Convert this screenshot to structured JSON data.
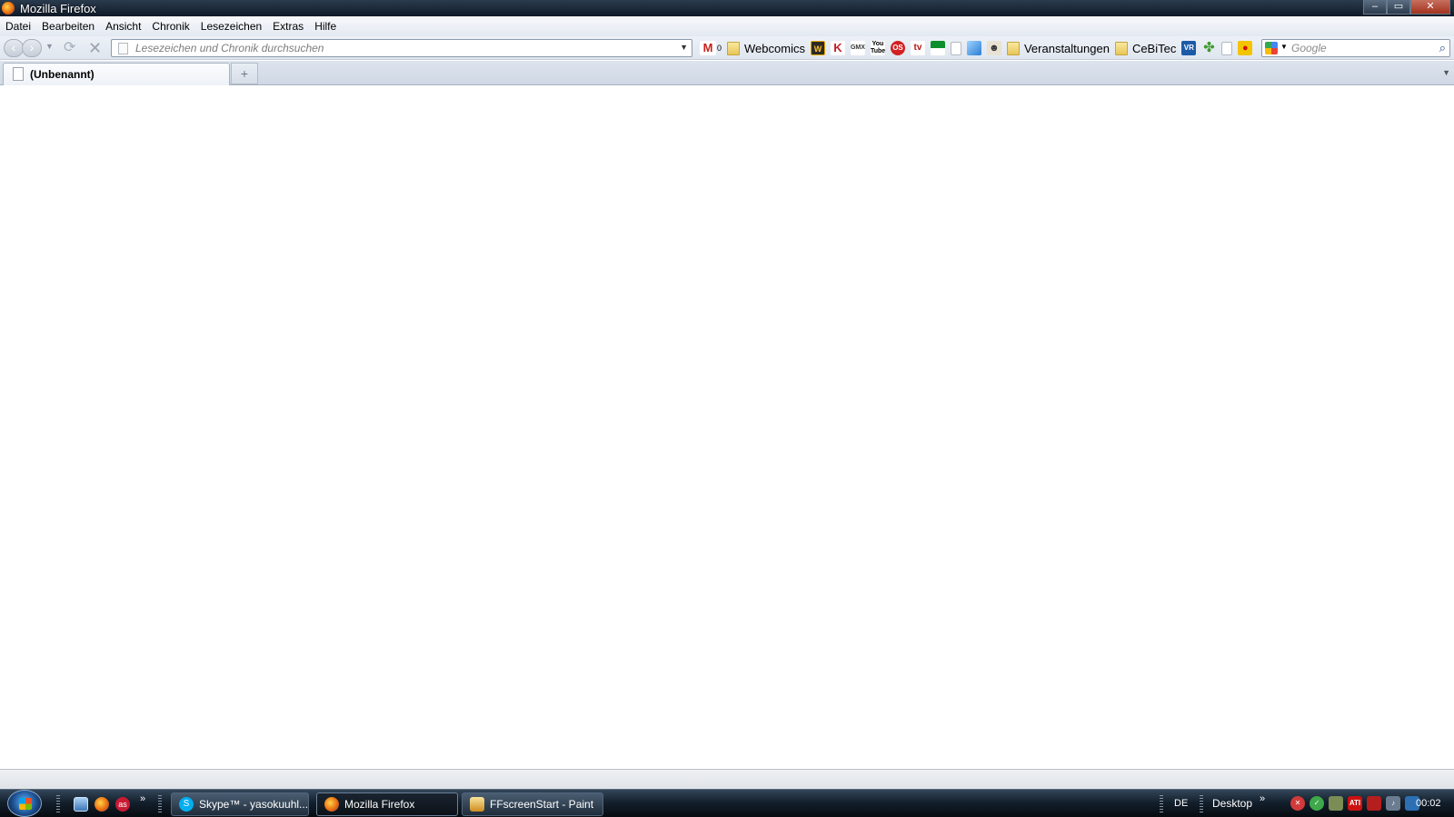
{
  "window": {
    "title": "Mozilla Firefox",
    "controls": {
      "minimize": "–",
      "maximize": "▭",
      "close": "✕"
    }
  },
  "menu": {
    "items": [
      "Datei",
      "Bearbeiten",
      "Ansicht",
      "Chronik",
      "Lesezeichen",
      "Extras",
      "Hilfe"
    ]
  },
  "nav": {
    "back_icon": "back-arrow-icon",
    "forward_icon": "forward-arrow-icon",
    "reload_icon": "reload-icon",
    "stop_icon": "stop-icon",
    "url_value": "",
    "url_placeholder": "Lesezeichen und Chronik durchsuchen"
  },
  "bookmarks": {
    "gmail_count": "0",
    "items": [
      {
        "label": "Webcomics",
        "icon": "folder-icon"
      },
      {
        "label": "Veranstaltungen",
        "icon": "folder-icon"
      },
      {
        "label": "CeBiTec",
        "icon": "folder-icon"
      }
    ],
    "icon_texts": {
      "wikipedia_de": "W",
      "kicker": "K",
      "gmx": "GMX",
      "youtube": "You Tube",
      "os": "OS",
      "tv": "tv",
      "vr": "VR"
    }
  },
  "search": {
    "value": "",
    "placeholder": "Google",
    "engine_icon": "google-icon"
  },
  "tabs": [
    {
      "label": "(Unbenannt)",
      "active": true
    }
  ],
  "newtab_label": "+",
  "taskbar": {
    "tasks": [
      {
        "label": "Skype™ - yasokuuhl...",
        "icon": "skype-icon",
        "active": false
      },
      {
        "label": "Mozilla Firefox",
        "icon": "firefox-icon",
        "active": true
      },
      {
        "label": "FFscreenStart - Paint",
        "icon": "paint-icon",
        "active": false
      }
    ],
    "language": "DE",
    "desktop_toolbar": "Desktop",
    "more": "»",
    "clock": "00:02"
  }
}
